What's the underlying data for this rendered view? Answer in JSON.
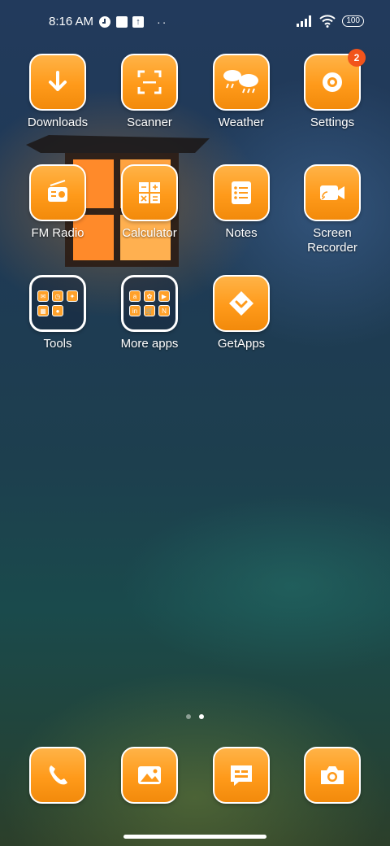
{
  "status_bar": {
    "time": "8:16 AM",
    "left_icons": [
      "notification-app-icon",
      "notification-square-icon",
      "upload-icon"
    ],
    "more": "··",
    "right_icons": [
      "signal-icon",
      "wifi-icon"
    ],
    "battery": "100"
  },
  "apps": [
    {
      "name": "downloads",
      "label": "Downloads",
      "icon": "download-arrow-icon"
    },
    {
      "name": "scanner",
      "label": "Scanner",
      "icon": "scanner-frame-icon"
    },
    {
      "name": "weather",
      "label": "Weather",
      "icon": "cloud-rain-icon"
    },
    {
      "name": "settings",
      "label": "Settings",
      "icon": "gear-icon",
      "badge": "2"
    },
    {
      "name": "fm-radio",
      "label": "FM Radio",
      "icon": "radio-icon"
    },
    {
      "name": "calculator",
      "label": "Calculator",
      "icon": "calculator-icon"
    },
    {
      "name": "notes",
      "label": "Notes",
      "icon": "notes-list-icon"
    },
    {
      "name": "screen-recorder",
      "label": "Screen\nRecorder",
      "icon": "video-camera-icon"
    },
    {
      "name": "tools-folder",
      "label": "Tools",
      "icon": "folder"
    },
    {
      "name": "more-apps-folder",
      "label": "More apps",
      "icon": "folder"
    },
    {
      "name": "getapps",
      "label": "GetApps",
      "icon": "getapps-diamond-icon"
    }
  ],
  "folders": {
    "tools": [
      "mail-icon",
      "clock-icon",
      "compass-icon",
      "grid-icon",
      "circle-app-icon"
    ],
    "more_apps": [
      "amazon-icon",
      "app-icon",
      "prime-video-icon",
      "linkedin-icon",
      "cart-icon",
      "n-app-icon"
    ]
  },
  "dock": [
    {
      "name": "phone",
      "icon": "phone-icon"
    },
    {
      "name": "gallery",
      "icon": "image-icon"
    },
    {
      "name": "messages",
      "icon": "message-icon"
    },
    {
      "name": "camera",
      "icon": "camera-icon"
    }
  ],
  "page_indicator": {
    "count": 2,
    "active": 2
  },
  "colors": {
    "tile": "#ff9a1a",
    "badge": "#f2541b"
  }
}
